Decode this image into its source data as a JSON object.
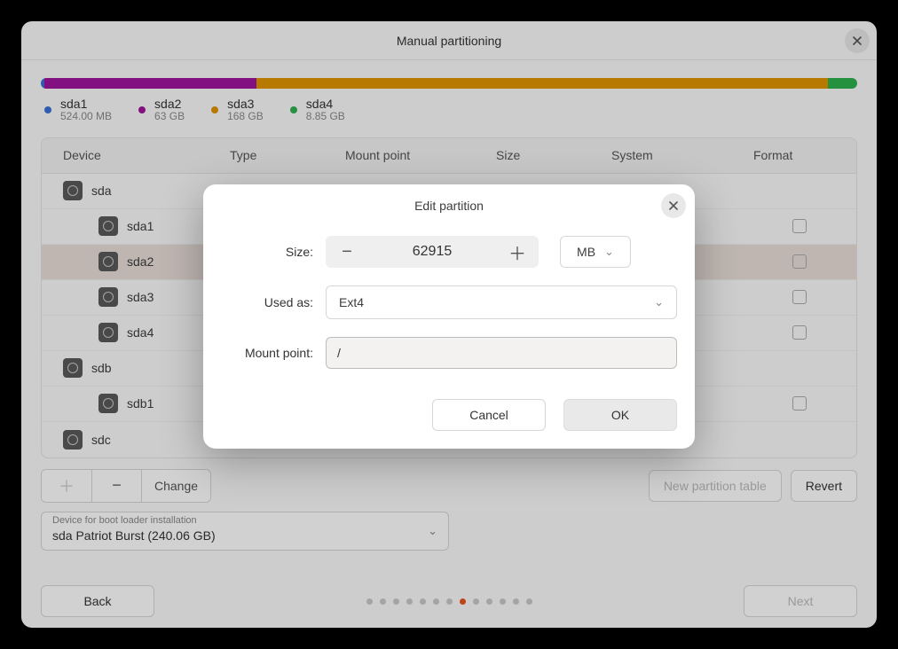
{
  "window": {
    "title": "Manual partitioning"
  },
  "usage": {
    "segments": [
      {
        "class": "seg-blue",
        "width": "0.4%"
      },
      {
        "class": "seg-purple",
        "width": "26%"
      },
      {
        "class": "seg-orange",
        "width": "70%"
      },
      {
        "class": "seg-green",
        "width": "3.6%"
      }
    ]
  },
  "legend": [
    {
      "color": "#3a6fd8",
      "name": "sda1",
      "size": "524.00 MB"
    },
    {
      "color": "#a0149e",
      "name": "sda2",
      "size": "63 GB"
    },
    {
      "color": "#e09400",
      "name": "sda3",
      "size": "168 GB"
    },
    {
      "color": "#2bb14c",
      "name": "sda4",
      "size": "8.85 GB"
    }
  ],
  "table": {
    "headers": {
      "device": "Device",
      "type": "Type",
      "mount": "Mount point",
      "size": "Size",
      "system": "System",
      "format": "Format"
    },
    "rows": [
      {
        "name": "sda",
        "child": false,
        "checkbox": false,
        "selected": false
      },
      {
        "name": "sda1",
        "child": true,
        "checkbox": true,
        "selected": false
      },
      {
        "name": "sda2",
        "child": true,
        "checkbox": true,
        "selected": true
      },
      {
        "name": "sda3",
        "child": true,
        "checkbox": true,
        "selected": false
      },
      {
        "name": "sda4",
        "child": true,
        "checkbox": true,
        "selected": false
      },
      {
        "name": "sdb",
        "child": false,
        "checkbox": false,
        "selected": false
      },
      {
        "name": "sdb1",
        "child": true,
        "checkbox": true,
        "selected": false
      },
      {
        "name": "sdc",
        "child": false,
        "checkbox": false,
        "selected": false
      }
    ]
  },
  "toolbar": {
    "change": "Change",
    "new_table": "New partition table",
    "revert": "Revert"
  },
  "bootloader": {
    "label": "Device for boot loader installation",
    "value": "sda Patriot Burst (240.06 GB)"
  },
  "footer": {
    "back": "Back",
    "next": "Next",
    "steps_total": 13,
    "step_active_index": 7
  },
  "modal": {
    "title": "Edit partition",
    "size_label": "Size:",
    "size_value": "62915",
    "size_unit": "MB",
    "used_as_label": "Used as:",
    "used_as_value": "Ext4",
    "mount_label": "Mount point:",
    "mount_value": "/",
    "cancel": "Cancel",
    "ok": "OK"
  }
}
